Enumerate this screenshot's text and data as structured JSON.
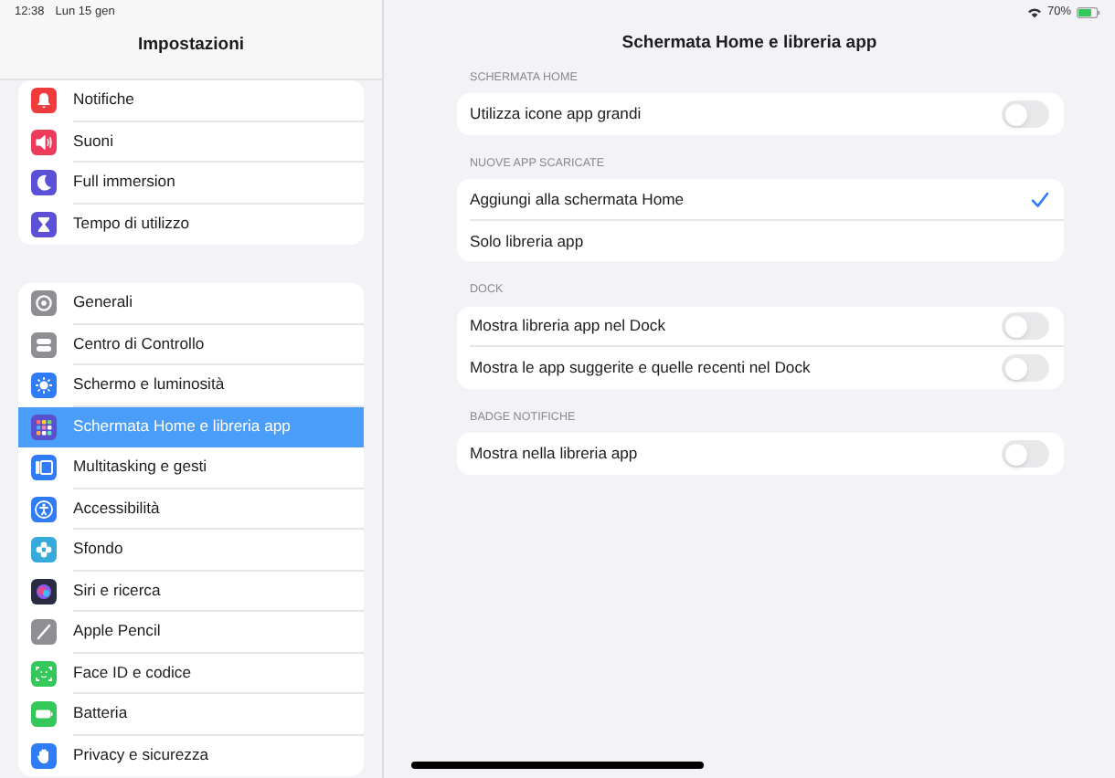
{
  "status_bar": {
    "time": "12:38",
    "date": "Lun 15 gen",
    "battery": "70%"
  },
  "sidebar": {
    "title": "Impostazioni",
    "groups": [
      {
        "items": [
          {
            "label": "Notifiche",
            "color": "#ef3b3b",
            "selected": false
          },
          {
            "label": "Suoni",
            "color": "#ec3c5c",
            "selected": false
          },
          {
            "label": "Full immersion",
            "color": "#5b50d6",
            "selected": false
          },
          {
            "label": "Tempo di utilizzo",
            "color": "#5b50d6",
            "selected": false
          }
        ]
      },
      {
        "items": [
          {
            "label": "Generali",
            "color": "#8e8e93",
            "selected": false
          },
          {
            "label": "Centro di Controllo",
            "color": "#8e8e93",
            "selected": false
          },
          {
            "label": "Schermo e luminosità",
            "color": "#2f7cf6",
            "selected": false
          },
          {
            "label": "Schermata Home e libreria app",
            "color": "#5a4fcf",
            "selected": true
          },
          {
            "label": "Multitasking e gesti",
            "color": "#2f7cf6",
            "selected": false
          },
          {
            "label": "Accessibilità",
            "color": "#2f7cf6",
            "selected": false
          },
          {
            "label": "Sfondo",
            "color": "#37aadc",
            "selected": false
          },
          {
            "label": "Siri e ricerca",
            "color": "#2a2a40",
            "selected": false
          },
          {
            "label": "Apple Pencil",
            "color": "#8e8e93",
            "selected": false
          },
          {
            "label": "Face ID e codice",
            "color": "#34c759",
            "selected": false
          },
          {
            "label": "Batteria",
            "color": "#34c759",
            "selected": false
          },
          {
            "label": "Privacy e sicurezza",
            "color": "#2f7cf6",
            "selected": false
          }
        ]
      }
    ]
  },
  "detail": {
    "title": "Schermata Home e libreria app",
    "sections": [
      {
        "header": "SCHERMATA HOME",
        "rows": [
          {
            "kind": "toggle",
            "label": "Utilizza icone app grandi",
            "on": false
          }
        ]
      },
      {
        "header": "NUOVE APP SCARICATE",
        "rows": [
          {
            "kind": "choice",
            "label": "Aggiungi alla schermata Home",
            "selected": true
          },
          {
            "kind": "choice",
            "label": "Solo libreria app",
            "selected": false
          }
        ]
      },
      {
        "header": "DOCK",
        "rows": [
          {
            "kind": "toggle",
            "label": "Mostra libreria app nel Dock",
            "on": false
          },
          {
            "kind": "toggle",
            "label": "Mostra le app suggerite e quelle recenti nel Dock",
            "on": false
          }
        ]
      },
      {
        "header": "BADGE NOTIFICHE",
        "rows": [
          {
            "kind": "toggle",
            "label": "Mostra nella libreria app",
            "on": false
          }
        ]
      }
    ]
  }
}
